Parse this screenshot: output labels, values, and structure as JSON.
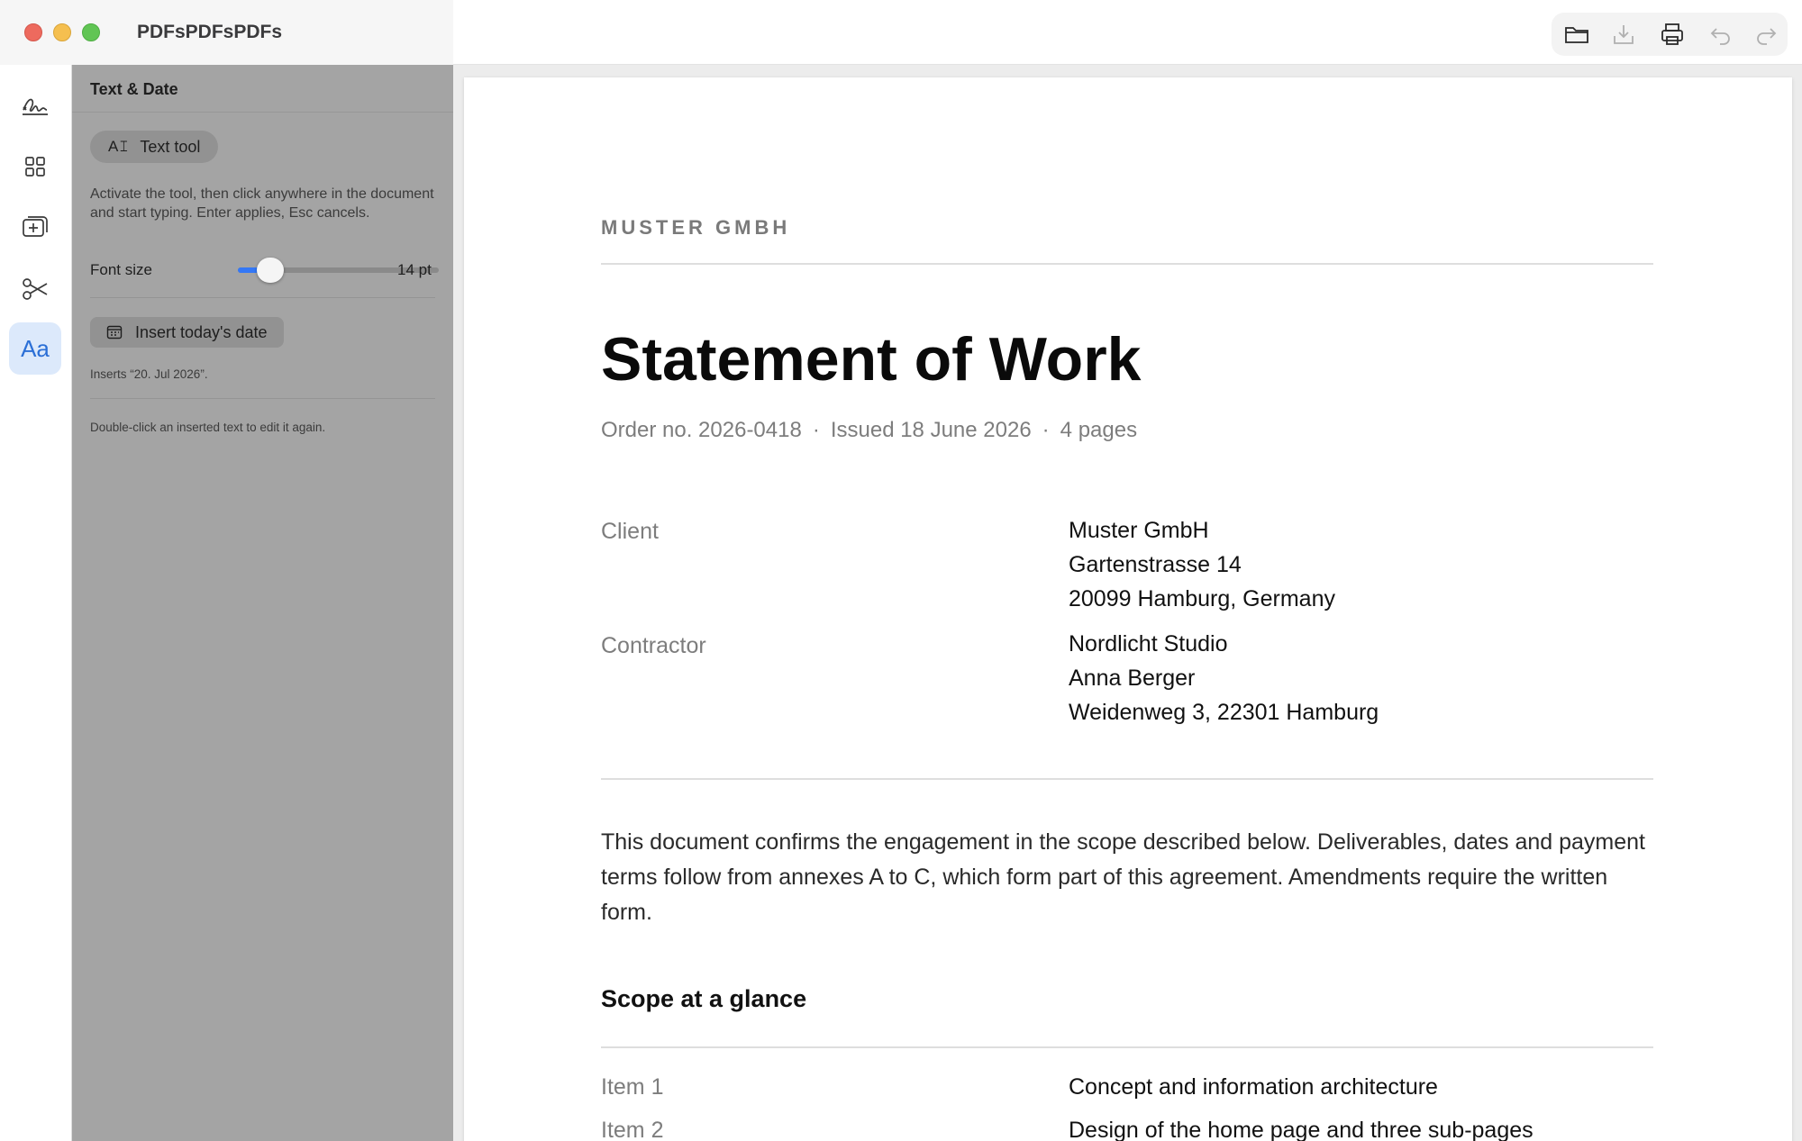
{
  "app": {
    "title": "PDFsPDFsPDFs"
  },
  "toolbar": {
    "icons": [
      "folder-icon",
      "download-icon",
      "print-icon",
      "undo-icon",
      "redo-icon"
    ]
  },
  "rail": {
    "items": [
      "signature-icon",
      "grid-icon",
      "add-page-icon",
      "scissors-icon",
      "text-aa-icon"
    ],
    "active_label": "Aa"
  },
  "panel": {
    "title": "Text & Date",
    "text_tool_icon": "A𝙸",
    "text_tool_label": "Text tool",
    "help_text": "Activate the tool, then click anywhere in the document and start typing. Enter applies, Esc cancels.",
    "font_size_label": "Font size",
    "font_size_value": "14 pt",
    "font_size_fraction": 0.11,
    "insert_date_label": "Insert today's date",
    "insert_hint": "Inserts “20. Jul 2026”.",
    "edit_hint": "Double-click an inserted text to edit it again.",
    "accent_color": "#3478f6"
  },
  "document": {
    "company": "MUSTER GMBH",
    "title": "Statement of Work",
    "meta": {
      "order": "Order no. 2026-0418",
      "issued": "Issued 18 June 2026",
      "pages": "4 pages",
      "separator": "·"
    },
    "client": {
      "label": "Client",
      "lines": [
        "Muster GmbH",
        "Gartenstrasse 14",
        "20099 Hamburg, Germany"
      ]
    },
    "contractor": {
      "label": "Contractor",
      "lines": [
        "Nordlicht Studio",
        "Anna Berger",
        "Weidenweg 3, 22301 Hamburg"
      ]
    },
    "intro": "This document confirms the engagement in the scope described below. Deliverables, dates and payment terms follow from annexes A to C, which form part of this agreement. Amendments require the written form.",
    "scope_heading": "Scope at a glance",
    "scope_items": [
      {
        "label": "Item 1",
        "value": "Concept and information architecture"
      },
      {
        "label": "Item 2",
        "value": "Design of the home page and three sub-pages"
      }
    ]
  }
}
